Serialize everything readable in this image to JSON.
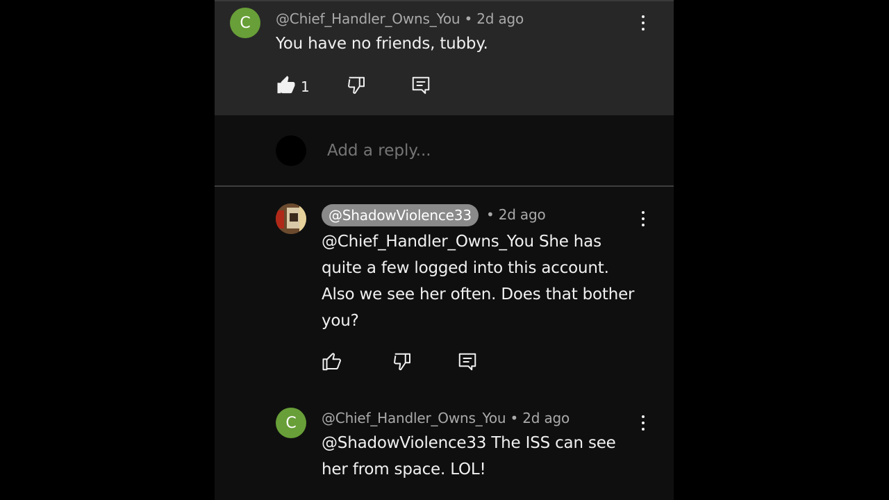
{
  "comments": {
    "top": {
      "avatar_letter": "C",
      "author": "@Chief_Handler_Owns_You",
      "time": " • 2d ago",
      "text": "You have no friends, tubby.",
      "likes": "1"
    },
    "reply_box": {
      "placeholder": "Add a reply..."
    },
    "reply1": {
      "author": "@ShadowViolence33",
      "time": "• 2d ago",
      "lines": [
        "@Chief_Handler_Owns_You  She has",
        "quite a few logged into this account.",
        "Also we see her often. Does that bother",
        "you?"
      ]
    },
    "reply2": {
      "avatar_letter": "C",
      "author": "@Chief_Handler_Owns_You",
      "time": " • 2d ago",
      "lines": [
        "@ShadowViolence33  The ISS can see",
        "her from space. LOL!"
      ]
    }
  },
  "colors": {
    "avatar_green": "#689f38",
    "panel_bg": "#0f0f0f",
    "highlight_bg": "#272727"
  },
  "icons": [
    "thumb-up-icon",
    "thumb-down-icon",
    "reply-icon",
    "more-vert-icon"
  ]
}
